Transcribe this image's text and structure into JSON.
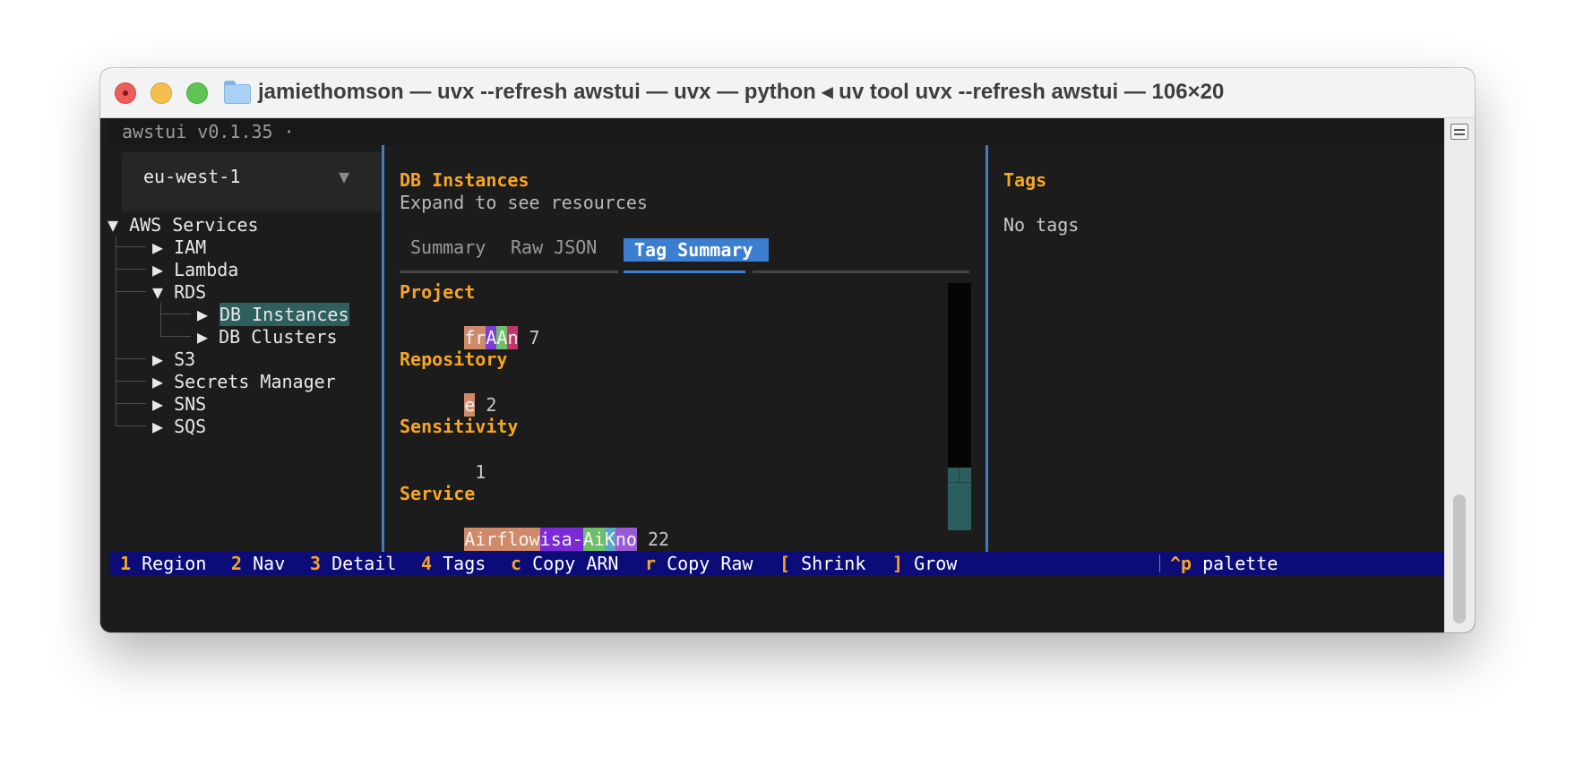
{
  "window": {
    "title": "jamiethomson — uvx --refresh awstui — uvx — python ◂ uv tool uvx --refresh awstui — 106×20"
  },
  "app": {
    "title": "awstui v0.1.35 ·"
  },
  "region": {
    "value": "eu-west-1",
    "arrow": "▼"
  },
  "tree": {
    "root": "▼ AWS Services",
    "items": [
      {
        "label": "▶ IAM"
      },
      {
        "label": "▶ Lambda"
      },
      {
        "label": "▼ RDS"
      },
      {
        "label": "▶ DB Clusters"
      },
      {
        "label": "▶ S3"
      },
      {
        "label": "▶ Secrets Manager"
      },
      {
        "label": "▶ SNS"
      },
      {
        "label": "▶ SQS"
      }
    ],
    "selected_arrow": "▶",
    "selected_label": "DB Instances"
  },
  "detail": {
    "heading": "DB Instances",
    "subheading": "Expand to see resources",
    "tabs": [
      "Summary",
      "Raw JSON",
      "Tag Summary"
    ],
    "active_tab": "Tag Summary",
    "tags": [
      {
        "key": "Project",
        "count": "7",
        "chips": [
          {
            "text": "fr",
            "color": "#cf8a6a"
          },
          {
            "text": "A",
            "color": "#7b3fd6"
          },
          {
            "text": "A",
            "color": "#6fbf6a"
          },
          {
            "text": "n",
            "color": "#c2356c"
          }
        ]
      },
      {
        "key": "Repository",
        "count": "2",
        "chips": [
          {
            "text": "e",
            "color": "#cf8a6a"
          }
        ]
      },
      {
        "key": "Sensitivity",
        "count": "1",
        "chips": []
      },
      {
        "key": "Service",
        "count": "22",
        "chips": [
          {
            "text": "Airflow",
            "color": "#cf8a6a"
          },
          {
            "text": "isa-",
            "color": "#7b2ad6"
          },
          {
            "text": "Ai",
            "color": "#6fbf6a"
          },
          {
            "text": "K",
            "color": "#5aa6c6"
          },
          {
            "text": "no",
            "color": "#9a5ad6"
          }
        ]
      }
    ]
  },
  "tags_panel": {
    "heading": "Tags",
    "empty_text": "No tags"
  },
  "footer": {
    "items": [
      {
        "key": "1",
        "label": "Region"
      },
      {
        "key": "2",
        "label": "Nav"
      },
      {
        "key": "3",
        "label": "Detail"
      },
      {
        "key": "4",
        "label": "Tags"
      },
      {
        "key": "c",
        "label": "Copy ARN"
      },
      {
        "key": "r",
        "label": "Copy Raw"
      },
      {
        "key": "[",
        "label": "Shrink"
      },
      {
        "key": "]",
        "label": "Grow"
      }
    ],
    "palette_key": "^p",
    "palette_label": "palette"
  }
}
